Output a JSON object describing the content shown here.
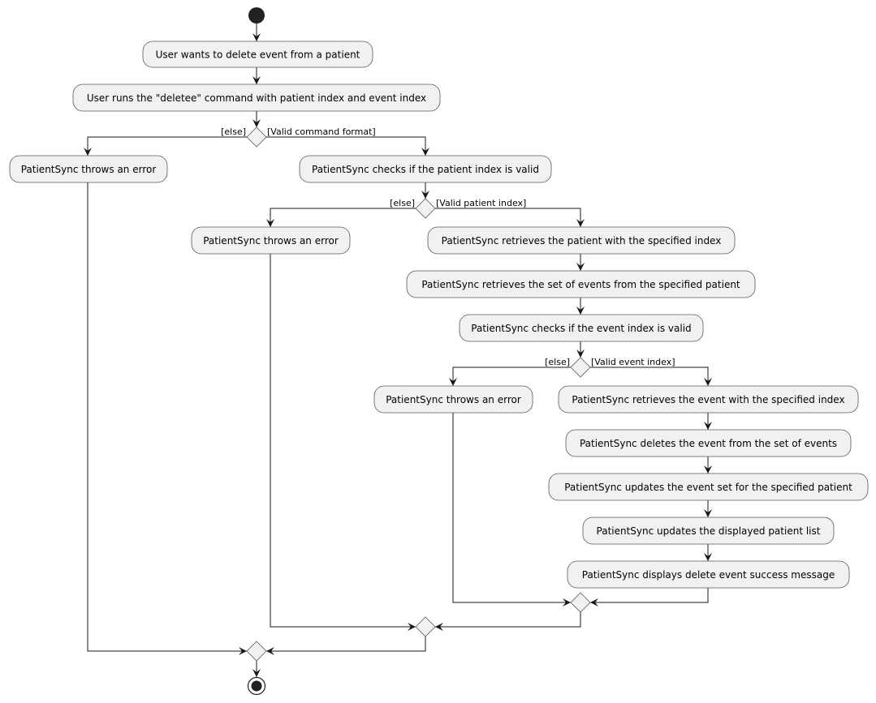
{
  "diagram": {
    "actions": {
      "a1": "User wants to delete event from a patient",
      "a2": "User runs the \"deletee\" command with patient index and event index",
      "err1": "PatientSync throws an error",
      "a3": "PatientSync checks if the patient index is valid",
      "err2": "PatientSync throws an error",
      "a4": "PatientSync retrieves the patient with the specified index",
      "a5": "PatientSync retrieves the set of events from the specified patient",
      "a6": "PatientSync checks if the event index is valid",
      "err3": "PatientSync throws an error",
      "a7": "PatientSync retrieves the event with the specified index",
      "a8": "PatientSync deletes the event from the set of events",
      "a9": "PatientSync updates the event set for the specified patient",
      "a10": "PatientSync updates the displayed patient list",
      "a11": "PatientSync displays delete event success message"
    },
    "guards": {
      "d1_else": "[else]",
      "d1_yes": "[Valid command format]",
      "d2_else": "[else]",
      "d2_yes": "[Valid patient index]",
      "d3_else": "[else]",
      "d3_yes": "[Valid event index]"
    },
    "colors": {
      "node_fill": "#F1F1F1",
      "line": "#181818",
      "start": "#222222"
    }
  }
}
